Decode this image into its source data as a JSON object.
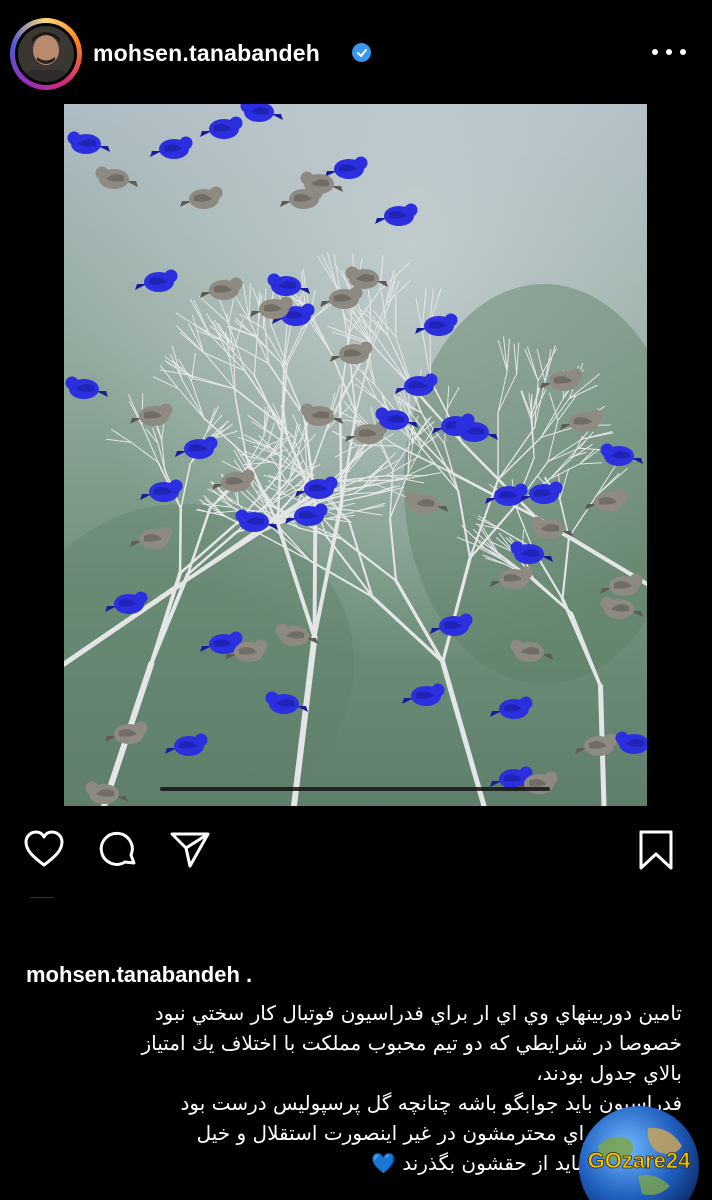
{
  "post": {
    "username": "mohsen.tanabandeh",
    "caption_user": "mohsen.tanabandeh .",
    "caption_lines": [
      "تامين دوربينهاي وي اي ار براي فدراسيون فوتبال كار سختي نبود",
      "خصوصا در شرايطي كه دو تيم محبوب مملكت با اختلاف يك امتياز",
      "بالاي جدول بودند،",
      "فدراسيون بايد جوابگو باشه چنانچه گل پرسپوليس درست بود",
      "تيم و هواداراي محترمشون در غير اينصورت استقلال و خيل",
      "هوادارانش نبايد از حقشون بگذرند"
    ],
    "caption_end_emoji": "💙"
  },
  "icons": {
    "verified": "verified-badge-icon",
    "more": "more-options-icon",
    "like": "heart-icon",
    "comment": "comment-icon",
    "share": "send-icon",
    "save": "bookmark-icon"
  },
  "watermark": {
    "text": "GOzare24"
  },
  "colors": {
    "background": "#000000",
    "verified": "#3897f0",
    "bird_blue": "#2b2fe0",
    "watermark_text": "#f7c400"
  }
}
